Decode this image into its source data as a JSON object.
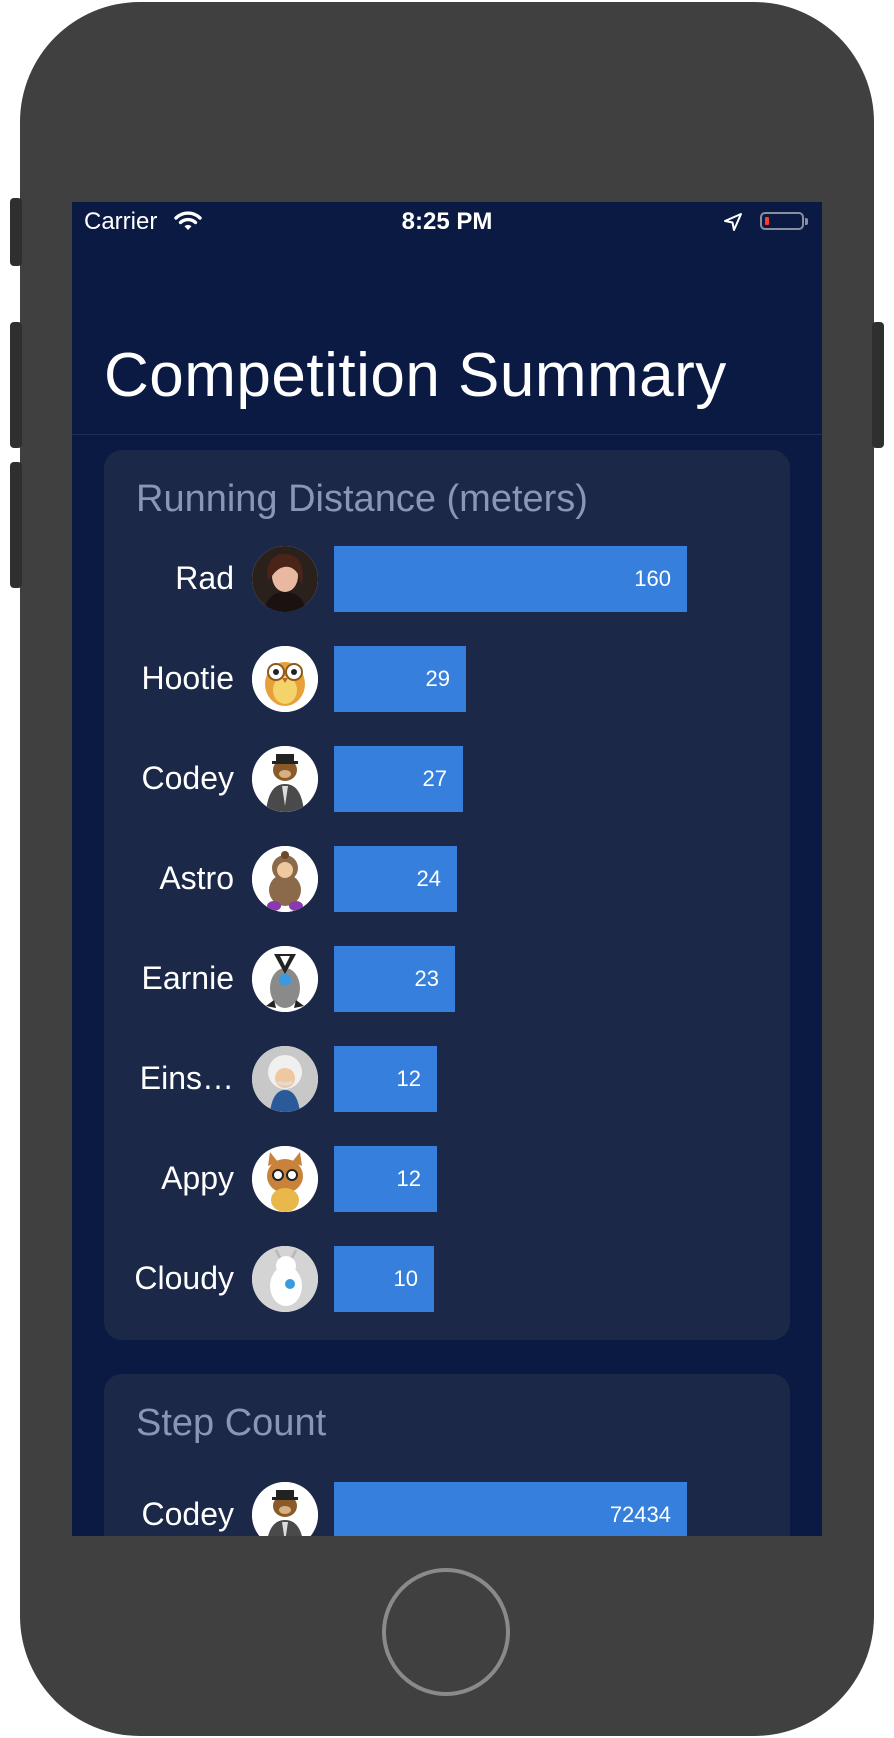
{
  "status_bar": {
    "carrier": "Carrier",
    "time": "8:25 PM"
  },
  "page": {
    "title": "Competition Summary"
  },
  "running": {
    "title": "Running Distance (meters)",
    "rows": [
      {
        "name": "Rad",
        "value": "160",
        "fraction": 1.0
      },
      {
        "name": "Hootie",
        "value": "29",
        "fraction": 0.373
      },
      {
        "name": "Codey",
        "value": "27",
        "fraction": 0.365
      },
      {
        "name": "Astro",
        "value": "24",
        "fraction": 0.349
      },
      {
        "name": "Earnie",
        "value": "23",
        "fraction": 0.344
      },
      {
        "name": "Eins…",
        "value": "12",
        "fraction": 0.293
      },
      {
        "name": "Appy",
        "value": "12",
        "fraction": 0.293
      },
      {
        "name": "Cloudy",
        "value": "10",
        "fraction": 0.283
      }
    ]
  },
  "steps": {
    "title": "Step Count",
    "rows": [
      {
        "name": "Codey",
        "value": "72434",
        "fraction": 1.0
      }
    ]
  },
  "colors": {
    "screen_background": "#0b1a43",
    "card_background": "#1b2848",
    "bar": "#367fdc",
    "card_title": "#8a96b7"
  },
  "icons": [
    "wifi-icon",
    "location-arrow-icon",
    "battery-icon"
  ]
}
